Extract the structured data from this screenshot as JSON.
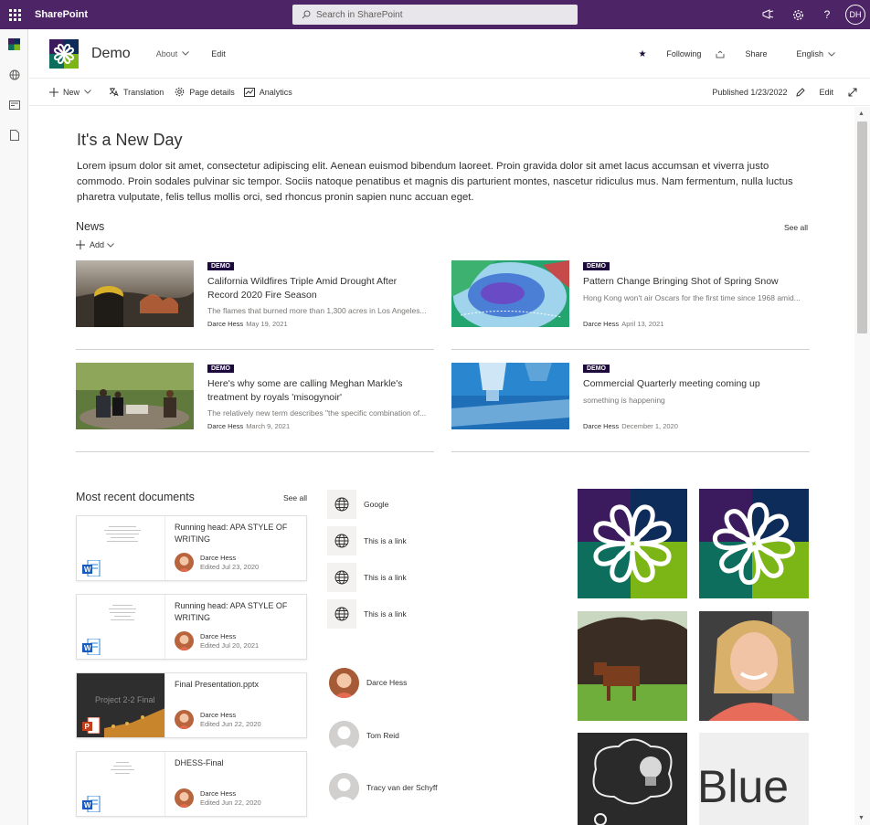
{
  "suite": {
    "brand": "SharePoint",
    "search_placeholder": "Search in SharePoint",
    "user_initials": "DH"
  },
  "site": {
    "title": "Demo",
    "nav": {
      "about": "About",
      "edit": "Edit"
    },
    "following": "Following",
    "share": "Share",
    "language": "English"
  },
  "commands": {
    "new": "New",
    "translation": "Translation",
    "page_details": "Page details",
    "analytics": "Analytics",
    "published": "Published 1/23/2022",
    "edit": "Edit"
  },
  "page": {
    "heading": "It's a New Day",
    "body": "Lorem ipsum dolor sit amet, consectetur adipiscing elit. Aenean euismod bibendum laoreet. Proin gravida dolor sit amet lacus accumsan et viverra justo commodo. Proin sodales pulvinar sic tempor. Sociis natoque penatibus et magnis dis parturient montes, nascetur ridiculus mus. Nam fermentum, nulla luctus pharetra vulputate, felis tellus mollis orci, sed rhoncus pronin sapien nunc accuan eget."
  },
  "news": {
    "title": "News",
    "see_all": "See all",
    "add": "Add",
    "items": [
      {
        "badge": "DEMO",
        "title": "California Wildfires Triple Amid Drought After Record 2020 Fire Season",
        "desc": "The flames that burned more than 1,300 acres in Los Angeles...",
        "author": "Darce Hess",
        "date": "May 19, 2021",
        "thumb": "wildfire"
      },
      {
        "badge": "DEMO",
        "title": "Pattern Change Bringing Shot of Spring Snow",
        "desc": "Hong Kong won't air Oscars for the first time since 1968 amid...",
        "author": "Darce Hess",
        "date": "April 13, 2021",
        "thumb": "weather-map"
      },
      {
        "badge": "DEMO",
        "title": "Here's why some are calling Meghan Markle's treatment by royals 'misogynoir'",
        "desc": "The relatively new term describes \"the specific combination of...",
        "author": "Darce Hess",
        "date": "March 9, 2021",
        "thumb": "interview"
      },
      {
        "badge": "DEMO",
        "title": "Commercial Quarterly meeting coming up",
        "desc": "something is happening",
        "author": "Darce Hess",
        "date": "December 1, 2020",
        "thumb": "microscope"
      }
    ]
  },
  "documents": {
    "title": "Most recent documents",
    "see_all": "See all",
    "items": [
      {
        "name": "Running head: APA STYLE OF WRITING",
        "author": "Darce Hess",
        "edited": "Edited Jul 23, 2020",
        "type": "word"
      },
      {
        "name": "Running head: APA STYLE OF WRITING",
        "author": "Darce Hess",
        "edited": "Edited Jul 20, 2021",
        "type": "word"
      },
      {
        "name": "Final Presentation.pptx",
        "author": "Darce Hess",
        "edited": "Edited Jun 22, 2020",
        "type": "powerpoint",
        "slide_title": "Project 2-2 Final"
      },
      {
        "name": "DHESS-Final",
        "author": "Darce Hess",
        "edited": "Edited Jun 22, 2020",
        "type": "word"
      }
    ]
  },
  "links": [
    {
      "label": "Google"
    },
    {
      "label": "This is a link"
    },
    {
      "label": "This is a link"
    },
    {
      "label": "This is a link"
    }
  ],
  "people": [
    {
      "name": "Darce Hess"
    },
    {
      "name": "Tom Reid"
    },
    {
      "name": "Tracy van der Schyff"
    }
  ],
  "gallery": {
    "blue_text": "Blue"
  },
  "colors": {
    "suite_bar": "#4d2466",
    "badge": "#1b0a3b",
    "logo_purple": "#3b1a5e",
    "logo_navy": "#0e2c5a",
    "logo_teal": "#0e6e5e",
    "logo_green": "#7cb516"
  }
}
